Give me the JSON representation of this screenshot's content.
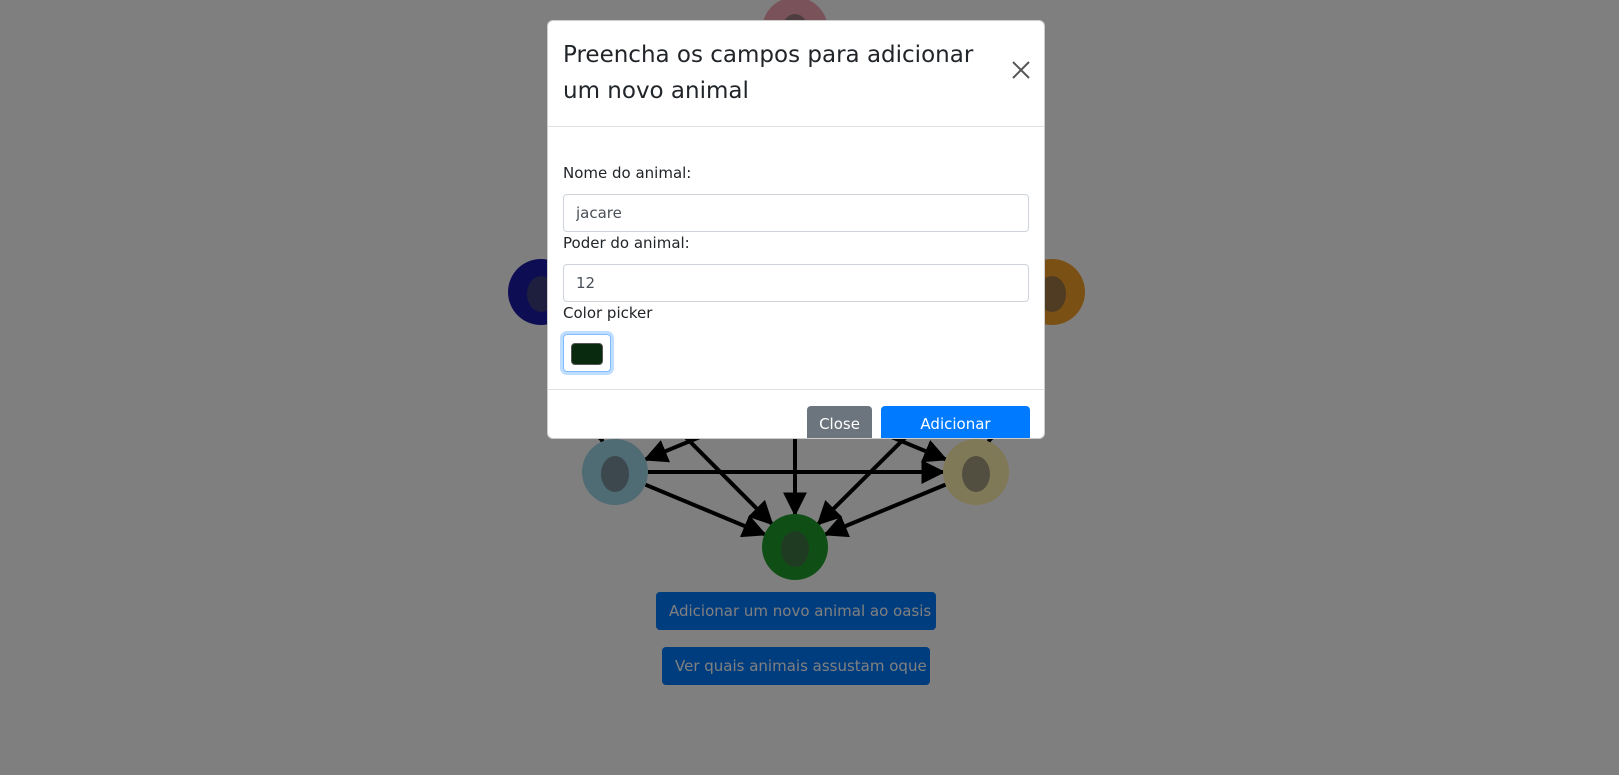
{
  "page": {
    "add_animal_button": "Adicionar um novo animal ao oasis",
    "view_relations_button": "Ver quais animais assustam oque"
  },
  "graph": {
    "nodes": [
      {
        "name": "rat-node",
        "icon": "rat-icon",
        "color": "#f4a6b4"
      },
      {
        "name": "rhino-node",
        "icon": "rhino-icon",
        "color": "#1a1aa8"
      },
      {
        "name": "tiger-node",
        "icon": "tiger-icon",
        "color": "#f4a02a"
      },
      {
        "name": "jaguar-node",
        "icon": "jaguar-icon",
        "color": "#9ed6e8"
      },
      {
        "name": "giraffe-node",
        "icon": "giraffe-icon",
        "color": "#fff3b0"
      },
      {
        "name": "ostrich-node",
        "icon": "ostrich-icon",
        "color": "#1f9e2c"
      }
    ]
  },
  "modal": {
    "title": "Preencha os campos para adicionar um novo animal",
    "name_label": "Nome do animal:",
    "name_value": "jacare",
    "power_label": "Poder do animal:",
    "power_value": "12",
    "color_label": "Color picker",
    "color_value": "#0a2a10",
    "close_button": "Close",
    "submit_button": "Adicionar Animal"
  }
}
